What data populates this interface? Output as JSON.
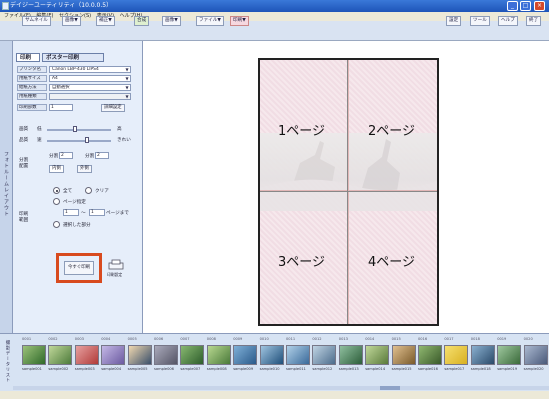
{
  "window": {
    "title": "デイジーユーティリティ（10.0.0.5）",
    "min": "_",
    "max": "□",
    "close": "×"
  },
  "menu": [
    "ファイル(F)",
    "編集(E)",
    "セクション(S)",
    "表示(V)",
    "ヘルプ(H)"
  ],
  "toolbar": {
    "left": [
      "サムネイル",
      "画像▼",
      "補正▼",
      "合成",
      "画像▼",
      "ファイル▼",
      "印刷▼"
    ],
    "right": [
      "設定",
      "ツール",
      "ヘルプ",
      "終了"
    ]
  },
  "sidebar_vertical_label": "フォトルームレイアウト",
  "print_panel": {
    "tabs": [
      "印刷",
      "ポスター印刷"
    ],
    "fields": [
      {
        "label": "プリンタ名",
        "value": "Canon LBP-430 LIPS4"
      },
      {
        "label": "用紙サイズ",
        "value": "A4"
      },
      {
        "label": "給紙方法",
        "value": "自動選択"
      },
      {
        "label": "用紙種類",
        "value": ""
      }
    ],
    "copies_label": "印刷部数",
    "copies_value": "1",
    "detail_button": "詳細設定",
    "quality_label": "画質",
    "quality_low": "低",
    "quality_high": "高",
    "speed_label": "品質",
    "speed_fast": "速",
    "speed_fine": "きれい",
    "split_label": "分割配置",
    "split_x_label": "分割",
    "split_x_value": "2",
    "split_y_label": "分割",
    "split_y_value": "2",
    "align_inner": "内側",
    "align_outer": "外側",
    "range_label": "印刷範囲",
    "radio_all": "全て",
    "radio_clip": "クリア",
    "radio_page": "ページ指定",
    "page_from": "1",
    "page_to": "1",
    "page_suffix": "ページまで",
    "radio_selected": "選択した部分",
    "print_button": "今すぐ印刷",
    "printer_icon_label": "印刷設定"
  },
  "preview": {
    "pages": [
      "1ページ",
      "2ページ",
      "3ページ",
      "4ページ"
    ]
  },
  "thumbnails": {
    "numbers": [
      "0001",
      "0002",
      "0003",
      "0004",
      "0005",
      "0006",
      "0007",
      "0008",
      "0009",
      "0010",
      "0011",
      "0012",
      "0013",
      "0014",
      "0015",
      "0016",
      "0017",
      "0018",
      "0019",
      "0020"
    ],
    "names": [
      "sample001",
      "sample002",
      "sample003",
      "sample004",
      "sample005",
      "sample006",
      "sample007",
      "sample008",
      "sample009",
      "sample010",
      "sample011",
      "sample012",
      "sample013",
      "sample014",
      "sample015",
      "sample016",
      "sample017",
      "sample018",
      "sample019",
      "sample020"
    ],
    "vertical_label": "撮影データリスト"
  },
  "colors": {
    "accent": "#d84a1e",
    "titlebar": "#2a62c8",
    "panel": "#e6eefa"
  }
}
